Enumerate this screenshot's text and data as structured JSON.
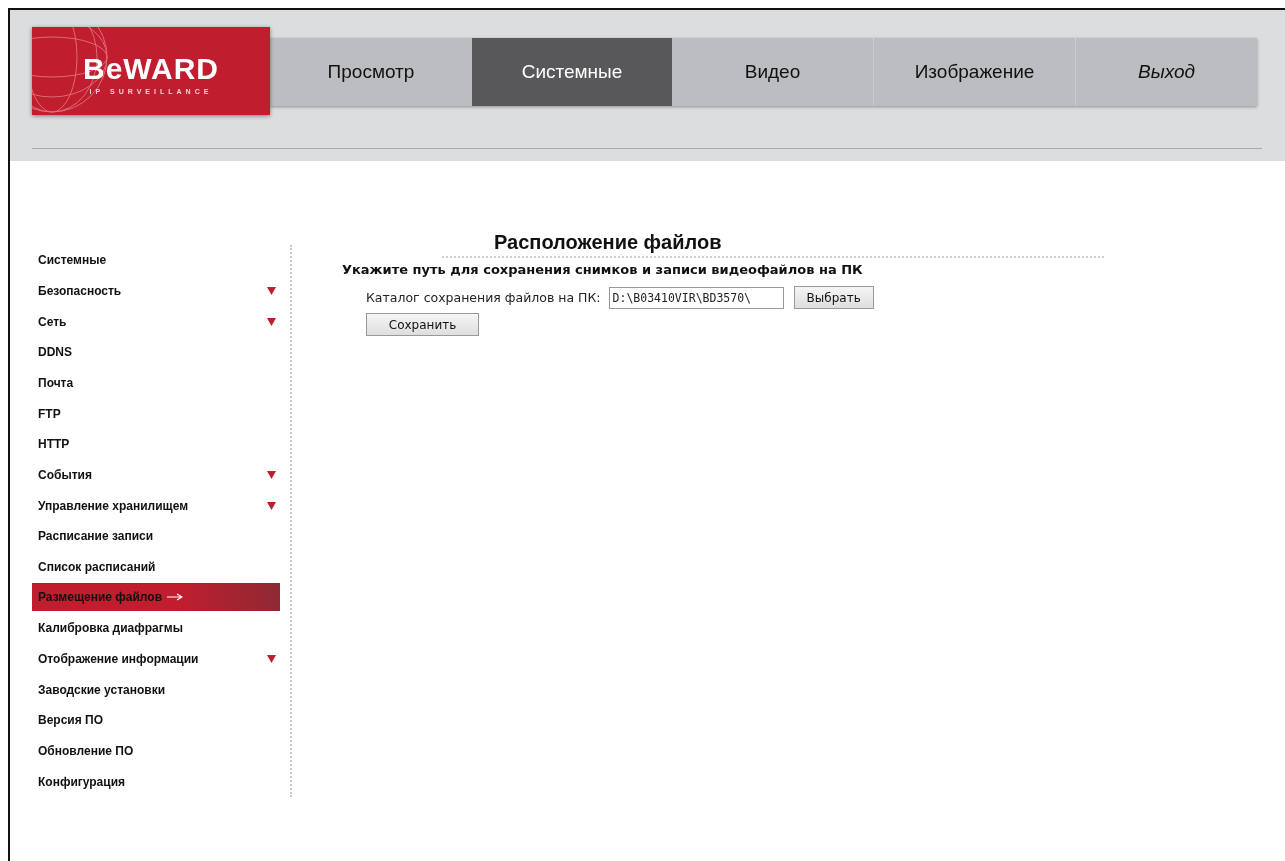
{
  "logo": {
    "brand": "BeWARD",
    "tagline": "IP SURVEILLANCE"
  },
  "nav": [
    {
      "label": "Просмотр",
      "selected": false,
      "italic": false
    },
    {
      "label": "Системные",
      "selected": true,
      "italic": false
    },
    {
      "label": "Видео",
      "selected": false,
      "italic": false
    },
    {
      "label": "Изображение",
      "selected": false,
      "italic": false
    },
    {
      "label": "Выход",
      "selected": false,
      "italic": true
    }
  ],
  "sidebar": {
    "items": [
      {
        "label": "Системные",
        "selected": false,
        "expandable": false
      },
      {
        "label": "Безопасность",
        "selected": false,
        "expandable": true
      },
      {
        "label": "Сеть",
        "selected": false,
        "expandable": true
      },
      {
        "label": "DDNS",
        "selected": false,
        "expandable": false
      },
      {
        "label": "Почта",
        "selected": false,
        "expandable": false
      },
      {
        "label": "FTP",
        "selected": false,
        "expandable": false
      },
      {
        "label": "HTTP",
        "selected": false,
        "expandable": false
      },
      {
        "label": "События",
        "selected": false,
        "expandable": true
      },
      {
        "label": "Управление хранилищем",
        "selected": false,
        "expandable": true
      },
      {
        "label": "Расписание записи",
        "selected": false,
        "expandable": false
      },
      {
        "label": "Список расписаний",
        "selected": false,
        "expandable": false
      },
      {
        "label": "Размещение файлов",
        "selected": true,
        "expandable": false
      },
      {
        "label": "Калибровка диафрагмы",
        "selected": false,
        "expandable": false
      },
      {
        "label": "Отображение информации",
        "selected": false,
        "expandable": true
      },
      {
        "label": "Заводские установки",
        "selected": false,
        "expandable": false
      },
      {
        "label": "Версия ПО",
        "selected": false,
        "expandable": false
      },
      {
        "label": "Обновление ПО",
        "selected": false,
        "expandable": false
      },
      {
        "label": "Конфигурация",
        "selected": false,
        "expandable": false
      }
    ]
  },
  "content": {
    "title": "Расположение файлов",
    "subtitle": "Укажите путь для сохранения снимков и записи видеофайлов на ПК",
    "field": {
      "label": "Каталог сохранения файлов на ПК:",
      "value": "D:\\B03410VIR\\BD3570\\"
    },
    "browse_button": "Выбрать",
    "save_button": "Сохранить"
  }
}
